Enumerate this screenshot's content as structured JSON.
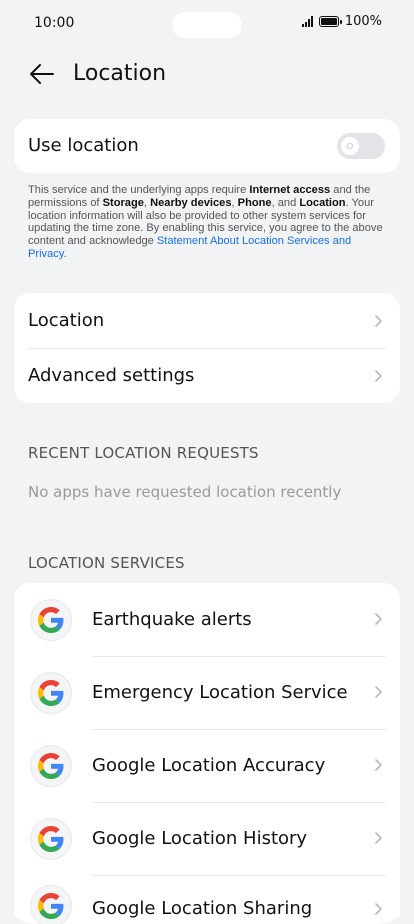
{
  "status_bar": {
    "time": "10:00",
    "battery": "100%",
    "icons": [
      "signal-icon",
      "battery-icon"
    ]
  },
  "header": {
    "title": "Location",
    "back_icon": "arrow-left-icon"
  },
  "use_location": {
    "label": "Use location",
    "enabled": false
  },
  "disclaimer": {
    "p1": "This service and the underlying apps require ",
    "b1": "Internet access",
    "p2": " and the permissions of ",
    "b2": "Storage",
    "p3": ", ",
    "b3": "Nearby devices",
    "p4": ", ",
    "b4": "Phone",
    "p5": ", and ",
    "b5": "Location",
    "p6": ". Your location information will also be provided to other system services for updating the time zone. By enabling this service, you agree to the above content and acknowledge ",
    "link": "Statement About Location Services and Privacy",
    "p7": "."
  },
  "settings": {
    "items": [
      {
        "label": "Location"
      },
      {
        "label": "Advanced settings"
      }
    ]
  },
  "recent_requests": {
    "header": "RECENT LOCATION REQUESTS",
    "empty": "No apps have requested location recently"
  },
  "location_services": {
    "header": "LOCATION SERVICES",
    "items": [
      {
        "label": "Earthquake alerts",
        "icon": "google-g-icon"
      },
      {
        "label": "Emergency Location Service",
        "icon": "google-g-icon"
      },
      {
        "label": "Google Location Accuracy",
        "icon": "google-g-icon"
      },
      {
        "label": "Google Location History",
        "icon": "google-g-icon"
      },
      {
        "label": "Google Location Sharing",
        "icon": "google-g-icon"
      }
    ]
  },
  "colors": {
    "background": "#f1f3f5",
    "card": "#ffffff",
    "link": "#1a6fe0",
    "google_blue": "#4285F4",
    "google_red": "#EA4335",
    "google_yellow": "#FBBC05",
    "google_green": "#34A853"
  }
}
